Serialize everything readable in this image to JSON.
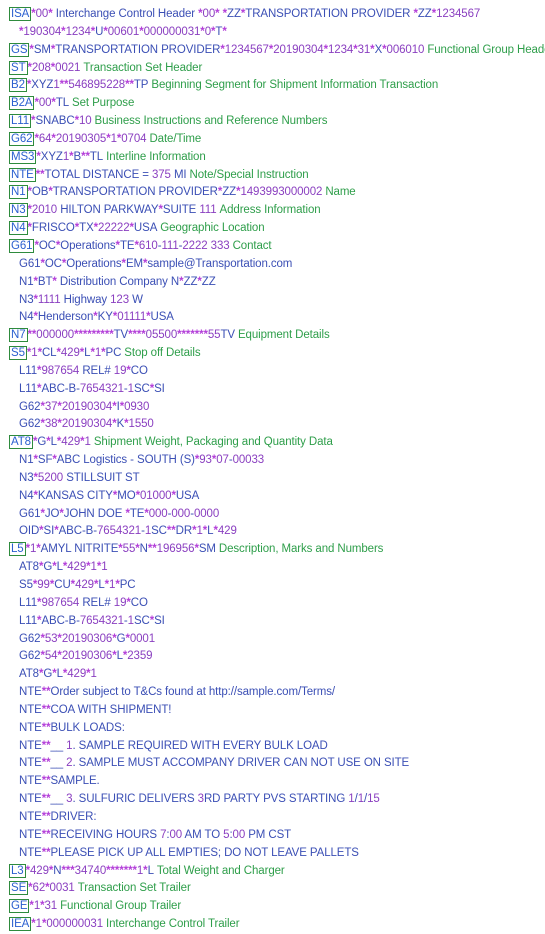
{
  "document": {
    "type": "edi-x12-204-transaction",
    "colors": {
      "segment_id_border": "#2e8b3d",
      "segment_id_text": "#2b5fd0",
      "separator": "#b33fd9",
      "alpha_value": "#3b4fb5",
      "numeric_value": "#8a3fc0",
      "description": "#2e9e4a",
      "background": "#ffffff"
    },
    "lines": [
      {
        "boxed": true,
        "seg": "ISA",
        "body": "*00* Interchange Control Header *00* *ZZ*TRANSPORTATION PROVIDER *ZZ*1234567",
        "desc": ""
      },
      {
        "continuation": true,
        "seg": "",
        "body": "*190304*1234*U*00601*000000031*0*T*",
        "desc": ""
      },
      {
        "boxed": true,
        "seg": "GS",
        "body": "*SM*TRANSPORTATION PROVIDER*1234567*20190304*1234*31*X*006010",
        "desc": "Functional Group Header"
      },
      {
        "boxed": true,
        "seg": "ST",
        "body": "*208*0021",
        "desc": "Transaction Set Header"
      },
      {
        "boxed": true,
        "seg": "B2",
        "body": "*XYZ1**546895228**TP",
        "desc": "Beginning Segment for Shipment Information Transaction"
      },
      {
        "boxed": true,
        "seg": "B2A",
        "body": "*00*TL",
        "desc": "Set Purpose"
      },
      {
        "boxed": true,
        "seg": "L11",
        "body": "*SNABC*10",
        "desc": "Business Instructions and Reference Numbers"
      },
      {
        "boxed": true,
        "seg": "G62",
        "body": "*64*20190305*1*0704",
        "desc": "Date/Time"
      },
      {
        "boxed": true,
        "seg": "MS3",
        "body": "*XYZ1*B**TL",
        "desc": "Interline Information"
      },
      {
        "boxed": true,
        "seg": "NTE",
        "body": "**TOTAL DISTANCE = 375 MI",
        "desc": "Note/Special Instruction"
      },
      {
        "boxed": true,
        "seg": "N1",
        "body": "*OB*TRANSPORTATION PROVIDER*ZZ*1493993000002",
        "desc": "Name"
      },
      {
        "boxed": true,
        "seg": "N3",
        "body": "*2010 HILTON PARKWAY*SUITE 111",
        "desc": "Address Information"
      },
      {
        "boxed": true,
        "seg": "N4",
        "body": "*FRISCO*TX*22222*USA",
        "desc": "Geographic Location"
      },
      {
        "boxed": true,
        "seg": "G61",
        "body": "*OC*Operations*TE*610-111-2222 333",
        "desc": "Contact"
      },
      {
        "continuation": true,
        "seg": "G61",
        "body": "*OC*Operations*EM*sample@Transportation.com",
        "desc": ""
      },
      {
        "continuation": true,
        "seg": "N1",
        "body": "*BT* Distribution Company N*ZZ*ZZ",
        "desc": ""
      },
      {
        "continuation": true,
        "seg": "N3",
        "body": "*1111 Highway 123 W",
        "desc": ""
      },
      {
        "continuation": true,
        "seg": "N4",
        "body": "*Henderson*KY*01111*USA",
        "desc": ""
      },
      {
        "boxed": true,
        "seg": "N7",
        "body": "**000000*********TV****05500*******55TV",
        "desc": "Equipment Details"
      },
      {
        "boxed": true,
        "seg": "S5",
        "body": "*1*CL*429*L*1*PC",
        "desc": "Stop off Details"
      },
      {
        "continuation": true,
        "seg": "L11",
        "body": "*987654 REL# 19*CO",
        "desc": ""
      },
      {
        "continuation": true,
        "seg": "L11",
        "body": "*ABC-B-7654321-1SC*SI",
        "desc": ""
      },
      {
        "continuation": true,
        "seg": "G62",
        "body": "*37*20190304*I*0930",
        "desc": ""
      },
      {
        "continuation": true,
        "seg": "G62",
        "body": "*38*20190304*K*1550",
        "desc": ""
      },
      {
        "boxed": true,
        "seg": "AT8",
        "body": "*G*L*429*1",
        "desc": "Shipment Weight, Packaging and Quantity Data"
      },
      {
        "continuation": true,
        "seg": "N1",
        "body": "*SF*ABC Logistics - SOUTH (S)*93*07-00033",
        "desc": ""
      },
      {
        "continuation": true,
        "seg": "N3",
        "body": "*5200 STILLSUIT ST",
        "desc": ""
      },
      {
        "continuation": true,
        "seg": "N4",
        "body": "*KANSAS CITY*MO*01000*USA",
        "desc": ""
      },
      {
        "continuation": true,
        "seg": "G61",
        "body": "*JO*JOHN DOE *TE*000-000-0000",
        "desc": ""
      },
      {
        "continuation": true,
        "seg": "OID",
        "body": "*SI*ABC-B-7654321-1SC**DR*1*L*429",
        "desc": ""
      },
      {
        "boxed": true,
        "seg": "L5",
        "body": "*1*AMYL NITRITE*55*N**196956*SM",
        "desc": "Description, Marks and Numbers"
      },
      {
        "continuation": true,
        "seg": "AT8",
        "body": "*G*L*429*1*1",
        "desc": ""
      },
      {
        "continuation": true,
        "seg": "S5",
        "body": "*99*CU*429*L*1*PC",
        "desc": ""
      },
      {
        "continuation": true,
        "seg": "L11",
        "body": "*987654 REL# 19*CO",
        "desc": ""
      },
      {
        "continuation": true,
        "seg": "L11",
        "body": "*ABC-B-7654321-1SC*SI",
        "desc": ""
      },
      {
        "continuation": true,
        "seg": "G62",
        "body": "*53*20190306*G*0001",
        "desc": ""
      },
      {
        "continuation": true,
        "seg": "G62",
        "body": "*54*20190306*L*2359",
        "desc": ""
      },
      {
        "continuation": true,
        "seg": "AT8",
        "body": "*G*L*429*1",
        "desc": ""
      },
      {
        "continuation": true,
        "seg": "NTE",
        "body": "**Order subject to T&Cs found at http://sample.com/Terms/",
        "desc": ""
      },
      {
        "continuation": true,
        "seg": "NTE",
        "body": "**COA WITH SHIPMENT!",
        "desc": ""
      },
      {
        "continuation": true,
        "seg": "NTE",
        "body": "**BULK LOADS:",
        "desc": ""
      },
      {
        "continuation": true,
        "seg": "NTE",
        "body": "**__ 1. SAMPLE REQUIRED WITH EVERY BULK LOAD",
        "desc": ""
      },
      {
        "continuation": true,
        "seg": "NTE",
        "body": "**__ 2. SAMPLE MUST ACCOMPANY DRIVER CAN NOT USE ON SITE",
        "desc": ""
      },
      {
        "continuation": true,
        "seg": "NTE",
        "body": "**SAMPLE.",
        "desc": ""
      },
      {
        "continuation": true,
        "seg": "NTE",
        "body": "**__ 3. SULFURIC DELIVERS 3RD PARTY PVS STARTING 1/1/15",
        "desc": ""
      },
      {
        "continuation": true,
        "seg": "NTE",
        "body": "**DRIVER:",
        "desc": ""
      },
      {
        "continuation": true,
        "seg": "NTE",
        "body": "**RECEIVING HOURS 7:00 AM TO 5:00 PM CST",
        "desc": ""
      },
      {
        "continuation": true,
        "seg": "NTE",
        "body": "**PLEASE PICK UP ALL EMPTIES; DO NOT LEAVE PALLETS",
        "desc": ""
      },
      {
        "boxed": true,
        "seg": "L3",
        "body": "*429*N***34740*******1*L",
        "desc": "Total Weight and Charger"
      },
      {
        "boxed": true,
        "seg": "SE",
        "body": "*62*0031",
        "desc": "Transaction Set Trailer"
      },
      {
        "boxed": true,
        "seg": "GE",
        "body": "*1*31",
        "desc": "Functional Group Trailer"
      },
      {
        "boxed": true,
        "seg": "IEA",
        "body": "*1*000000031",
        "desc": "Interchange Control Trailer"
      }
    ]
  }
}
